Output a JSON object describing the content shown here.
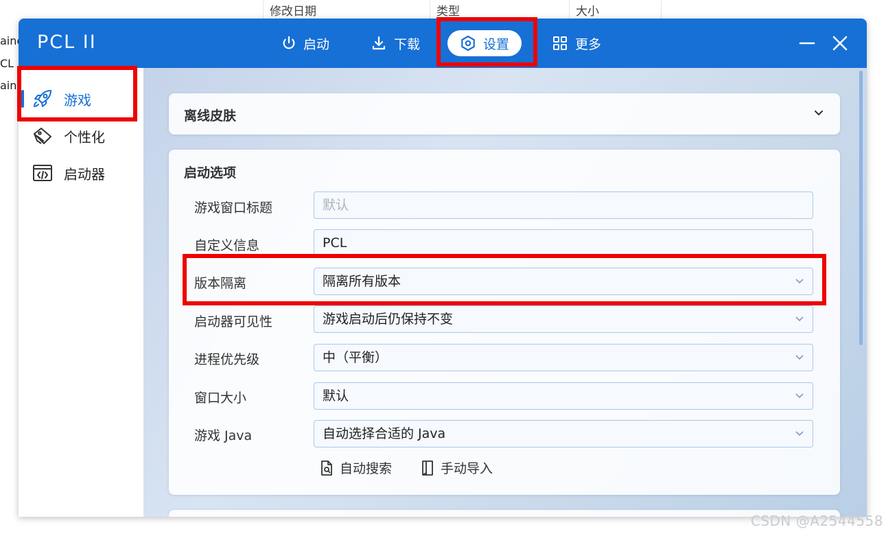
{
  "background": {
    "columns": [
      "修改日期",
      "类型",
      "大小"
    ],
    "left_fragments": [
      "aine",
      "CL",
      "ain"
    ]
  },
  "window": {
    "title": "PCL II",
    "nav": [
      {
        "label": "启动",
        "icon": "power-icon"
      },
      {
        "label": "下载",
        "icon": "download-icon"
      },
      {
        "label": "设置",
        "icon": "settings-icon",
        "active": true
      },
      {
        "label": "更多",
        "icon": "grid-icon"
      }
    ]
  },
  "sidebar": {
    "items": [
      {
        "label": "游戏",
        "icon": "rocket-icon",
        "active": true
      },
      {
        "label": "个性化",
        "icon": "palette-icon"
      },
      {
        "label": "启动器",
        "icon": "code-window-icon"
      }
    ]
  },
  "offline_skin": {
    "title": "离线皮肤"
  },
  "launch_options": {
    "title": "启动选项",
    "rows": [
      {
        "label": "游戏窗口标题",
        "placeholder": "默认",
        "value": ""
      },
      {
        "label": "自定义信息",
        "value": "PCL"
      },
      {
        "label": "版本隔离",
        "value": "隔离所有版本"
      },
      {
        "label": "启动器可见性",
        "value": "游戏启动后仍保持不变"
      },
      {
        "label": "进程优先级",
        "value": "中（平衡）"
      },
      {
        "label": "窗口大小",
        "value": "默认"
      },
      {
        "label": "游戏 Java",
        "value": "自动选择合适的 Java"
      }
    ],
    "actions": [
      {
        "label": "自动搜索",
        "icon": "file-search-icon"
      },
      {
        "label": "手动导入",
        "icon": "import-icon"
      }
    ]
  },
  "watermark": "CSDN @A2544558",
  "colors": {
    "accent": "#1670d6",
    "highlight": "#ee0000"
  }
}
